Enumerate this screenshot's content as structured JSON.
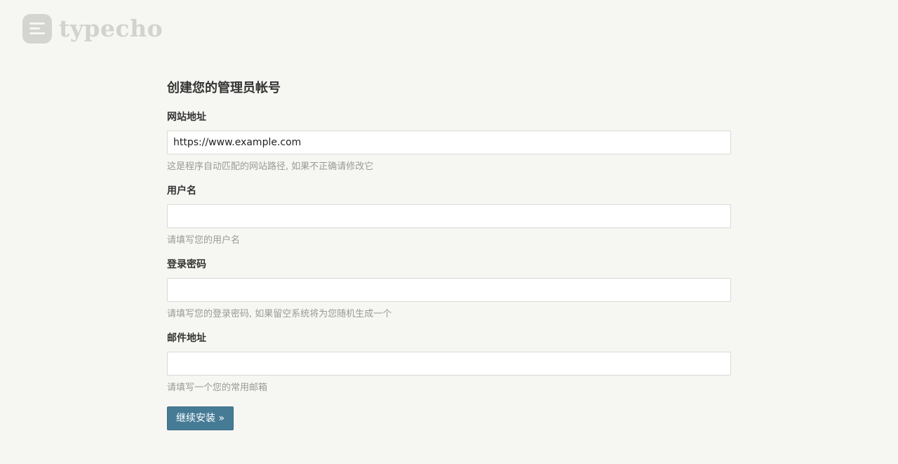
{
  "brand": {
    "logo_text": "typecho",
    "logo_icon": "typecho-logo-icon"
  },
  "form": {
    "title": "创建您的管理员帐号",
    "fields": [
      {
        "label": "网站地址",
        "value": "https://www.example.com",
        "placeholder": "",
        "hint": "这是程序自动匹配的网站路径, 如果不正确请修改它"
      },
      {
        "label": "用户名",
        "value": "",
        "placeholder": "",
        "hint": "请填写您的用户名"
      },
      {
        "label": "登录密码",
        "value": "",
        "placeholder": "",
        "hint": "请填写您的登录密码, 如果留空系统将为您随机生成一个"
      },
      {
        "label": "邮件地址",
        "value": "",
        "placeholder": "",
        "hint": "请填写一个您的常用邮箱"
      }
    ],
    "submit_label": "继续安装 »"
  },
  "colors": {
    "background": "#f6f6f3",
    "button": "#467b96",
    "hint": "#999999"
  }
}
